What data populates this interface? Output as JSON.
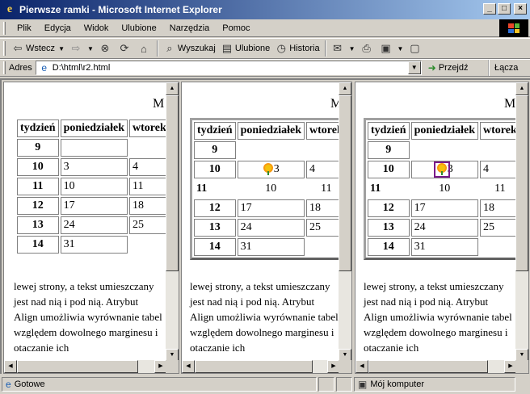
{
  "window": {
    "title": "Pierwsze ramki - Microsoft Internet Explorer"
  },
  "menu": [
    "Plik",
    "Edycja",
    "Widok",
    "Ulubione",
    "Narzędzia",
    "Pomoc"
  ],
  "toolbar": {
    "back": "Wstecz",
    "search": "Wyszukaj",
    "favorites": "Ulubione",
    "history": "Historia"
  },
  "address": {
    "label": "Adres",
    "value": "D:\\html\\r2.html",
    "go": "Przejdź",
    "links": "Łącza"
  },
  "frames": {
    "heading": "M",
    "table": {
      "headers": [
        "tydzień",
        "poniedziałek",
        "wtorek"
      ],
      "rows": [
        {
          "week": "9",
          "mon": "",
          "tue": ""
        },
        {
          "week": "10",
          "mon": "3",
          "tue": "4"
        },
        {
          "week": "11",
          "mon": "10",
          "tue": "11"
        },
        {
          "week": "12",
          "mon": "17",
          "tue": "18"
        },
        {
          "week": "13",
          "mon": "24",
          "tue": "25"
        },
        {
          "week": "14",
          "mon": "31",
          "tue": ""
        }
      ]
    },
    "paragraph": "lewej strony, a tekst umieszczany jest nad nią i pod nią. Atrybut Align umożliwia wyrównanie tabel względem dowolnego marginesu i otaczanie ich"
  },
  "status": {
    "text": "Gotowe",
    "zone": "Mój komputer"
  }
}
